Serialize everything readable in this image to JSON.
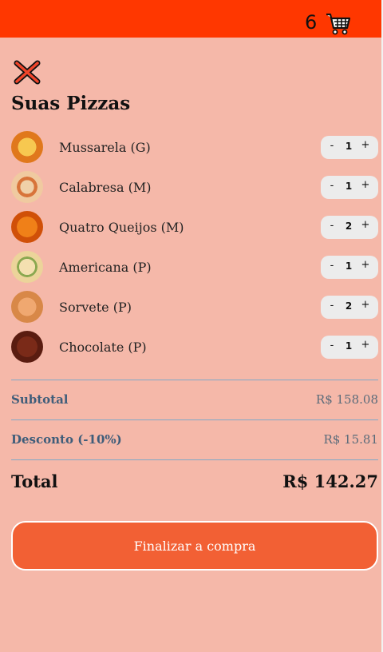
{
  "header": {
    "cart_count": "6",
    "cart_icon": "shopping-cart-icon",
    "color": "#ff3700"
  },
  "close_icon": "close-x-icon",
  "title": "Suas Pizzas",
  "items": [
    {
      "name": "Mussarela (G)",
      "quantity": "1",
      "minus": "-",
      "plus": "+",
      "image": "pizza-mussarela",
      "color": "#f0a030"
    },
    {
      "name": "Calabresa (M)",
      "quantity": "1",
      "minus": "-",
      "plus": "+",
      "image": "pizza-calabresa",
      "color": "#e8c38a"
    },
    {
      "name": "Quatro Queijos (M)",
      "quantity": "2",
      "minus": "-",
      "plus": "+",
      "image": "pizza-quatro-queijos",
      "color": "#e86a10"
    },
    {
      "name": "Americana (P)",
      "quantity": "1",
      "minus": "-",
      "plus": "+",
      "image": "pizza-americana",
      "color": "#e8d8a0"
    },
    {
      "name": "Sorvete (P)",
      "quantity": "2",
      "minus": "-",
      "plus": "+",
      "image": "pizza-sorvete",
      "color": "#d98a4a"
    },
    {
      "name": "Chocolate (P)",
      "quantity": "1",
      "minus": "-",
      "plus": "+",
      "image": "pizza-chocolate",
      "color": "#5a2418"
    }
  ],
  "summary": {
    "subtotal_label": "Subtotal",
    "subtotal_value": "R$ 158.08",
    "discount_label": "Desconto (-10%)",
    "discount_value": "R$ 15.81",
    "total_label": "Total",
    "total_value": "R$ 142.27"
  },
  "checkout_label": "Finalizar a compra",
  "colors": {
    "background": "#f5b8a9",
    "accent": "#f26034",
    "summary_label": "#3f5d7a"
  }
}
